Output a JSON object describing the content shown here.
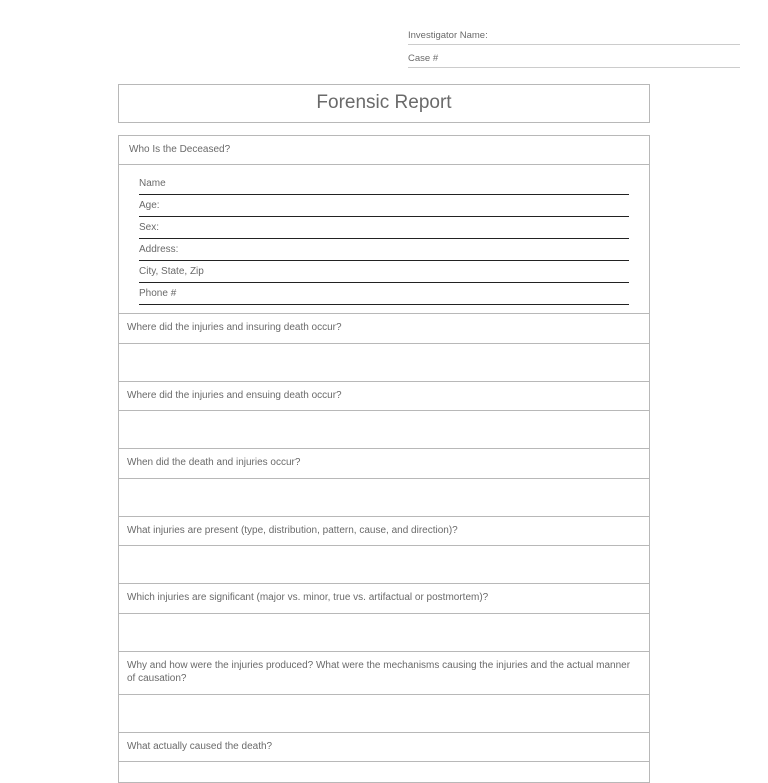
{
  "header": {
    "investigator_label": "Investigator Name:",
    "case_label": "Case #"
  },
  "title": "Forensic Report",
  "deceased_section": {
    "heading": "Who Is the Deceased?",
    "fields": [
      "Name",
      "Age:",
      "Sex:",
      "Address:",
      "City, State, Zip",
      "Phone #"
    ]
  },
  "questions": [
    "Where did the injuries and insuring death occur?",
    "Where did the injuries and ensuing death occur?",
    "When did the death and injuries occur?",
    "What injuries are present (type, distribution, pattern, cause, and direction)?",
    "Which injuries are significant (major vs. minor, true vs. artifactual or postmortem)?",
    "Why and how were the injuries produced?  What were the mechanisms causing the injuries and the actual manner of causation?",
    "What actually caused the death?"
  ]
}
